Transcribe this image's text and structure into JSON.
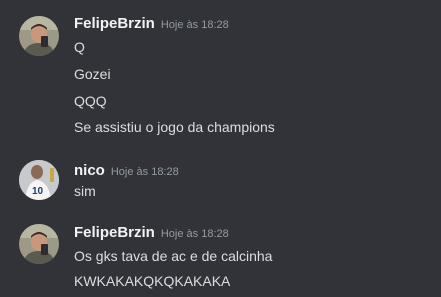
{
  "groups": [
    {
      "author": "FelipeBrzin",
      "time": "Hoje às 18:28",
      "avatar": "user-avatar-photo",
      "messages": [
        "Q",
        "Gozei",
        "QQQ",
        "Se assistiu o jogo da champions"
      ]
    },
    {
      "author": "nico",
      "time": "Hoje às 18:28",
      "avatar": "football-player-avatar",
      "messages": [
        "sim"
      ]
    },
    {
      "author": "FelipeBrzin",
      "time": "Hoje às 18:28",
      "avatar": "user-avatar-photo",
      "messages": [
        "Os gks tava de ac e de calcinha",
        "KWKAKAKQKQKAKAKA"
      ]
    }
  ],
  "colors": {
    "background": "#313338",
    "username": "#f2f3f5",
    "text": "#dbdee1",
    "timestamp": "#949ba4"
  }
}
